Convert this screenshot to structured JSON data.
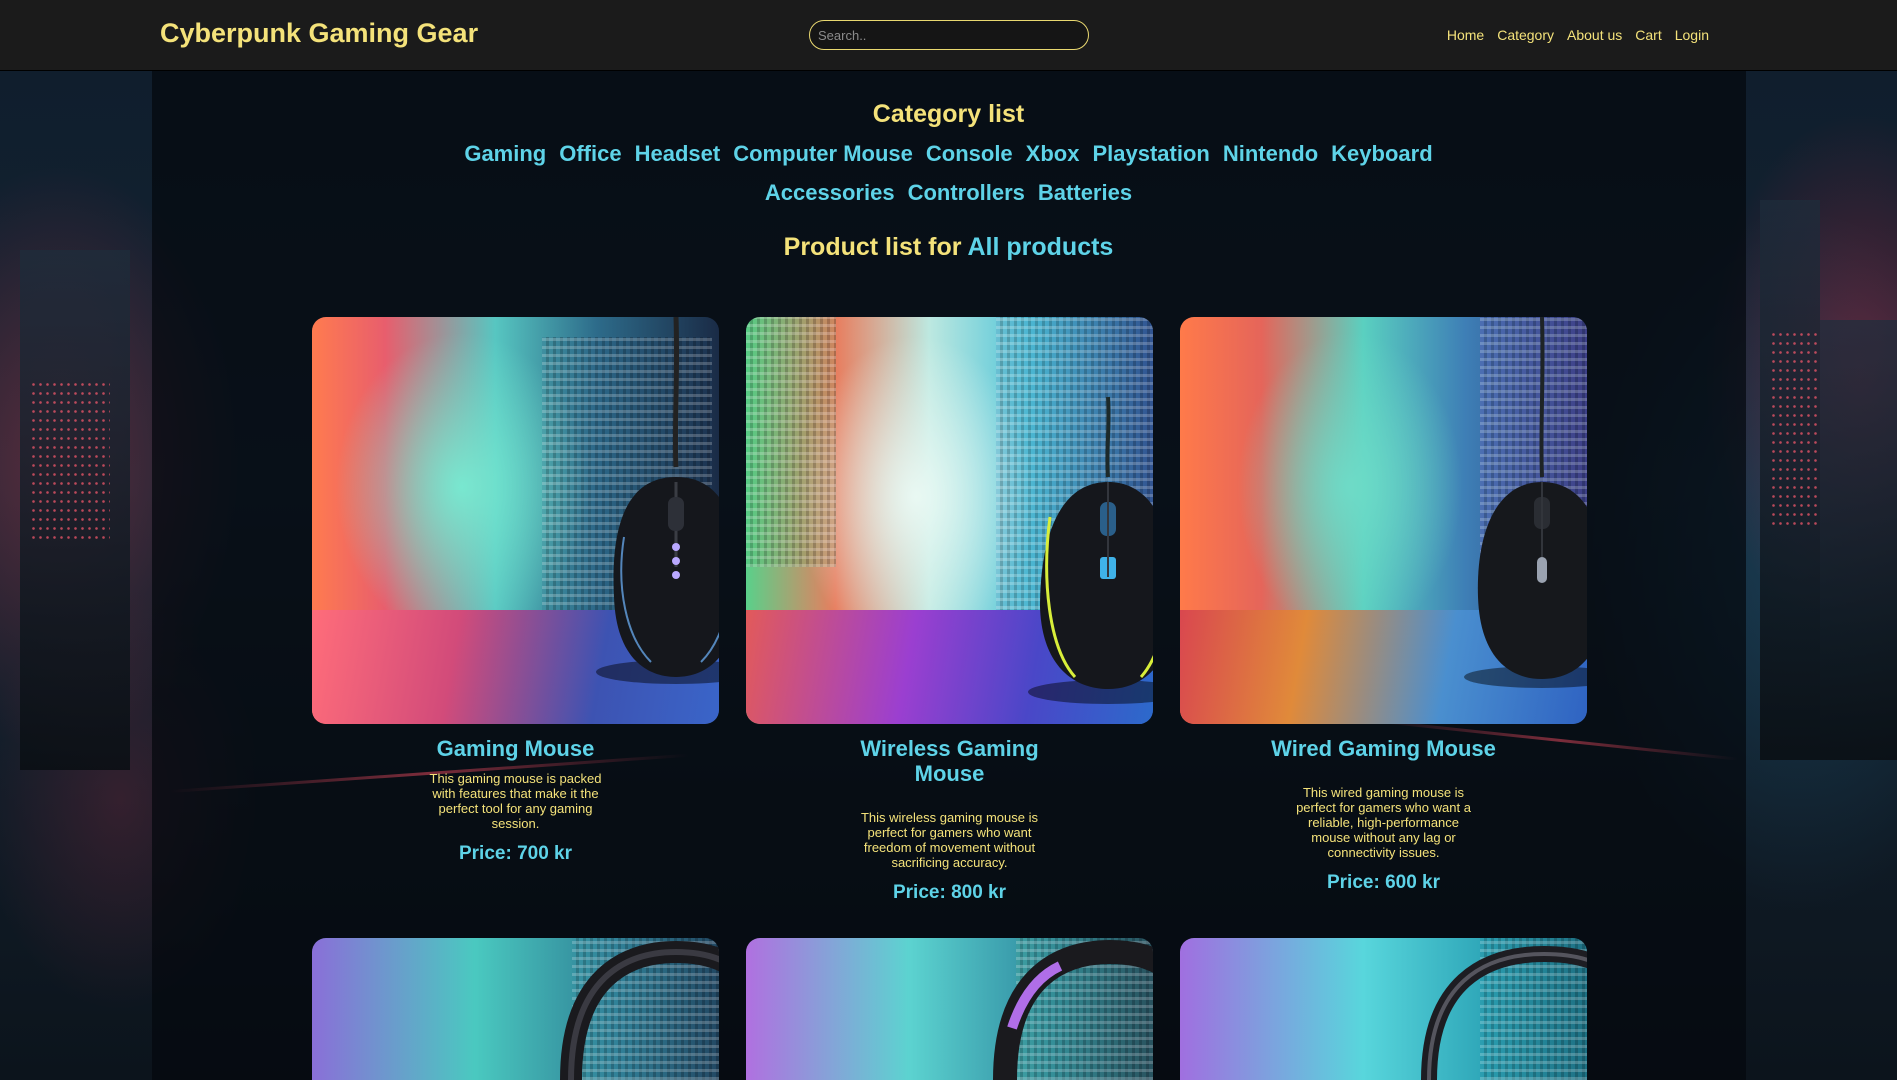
{
  "header": {
    "logo": "Cyberpunk Gaming Gear",
    "search_placeholder": "Search..",
    "nav": [
      "Home",
      "Category",
      "About us",
      "Cart",
      "Login"
    ]
  },
  "categories": {
    "heading": "Category list",
    "row1": [
      "Gaming",
      "Office",
      "Headset",
      "Computer Mouse",
      "Console",
      "Xbox",
      "Playstation",
      "Nintendo",
      "Keyboard"
    ],
    "row2": [
      "Accessories",
      "Controllers",
      "Batteries"
    ]
  },
  "product_list": {
    "prefix": "Product list for",
    "filter": "All products"
  },
  "products": [
    {
      "name": "Gaming Mouse",
      "description": "This gaming mouse is packed with features that make it the perfect tool for any gaming session.",
      "price": "Price: 700 kr",
      "image": "gaming-mouse-photo"
    },
    {
      "name": "Wireless Gaming Mouse",
      "description": "This wireless gaming mouse is perfect for gamers who want freedom of movement without sacrificing accuracy.",
      "price": "Price: 800 kr",
      "image": "wireless-gaming-mouse-photo"
    },
    {
      "name": "Wired Gaming Mouse",
      "description": "This wired gaming mouse is perfect for gamers who want a reliable, high-performance mouse without any lag or connectivity issues.",
      "price": "Price: 600 kr",
      "image": "wired-gaming-mouse-photo"
    },
    {
      "image": "headset-photo"
    },
    {
      "image": "headset-photo"
    },
    {
      "image": "headset-photo"
    }
  ],
  "colors": {
    "accent_yellow": "#f4e27a",
    "accent_cyan": "#5ed3e8",
    "topbar": "#1b1b1b"
  }
}
